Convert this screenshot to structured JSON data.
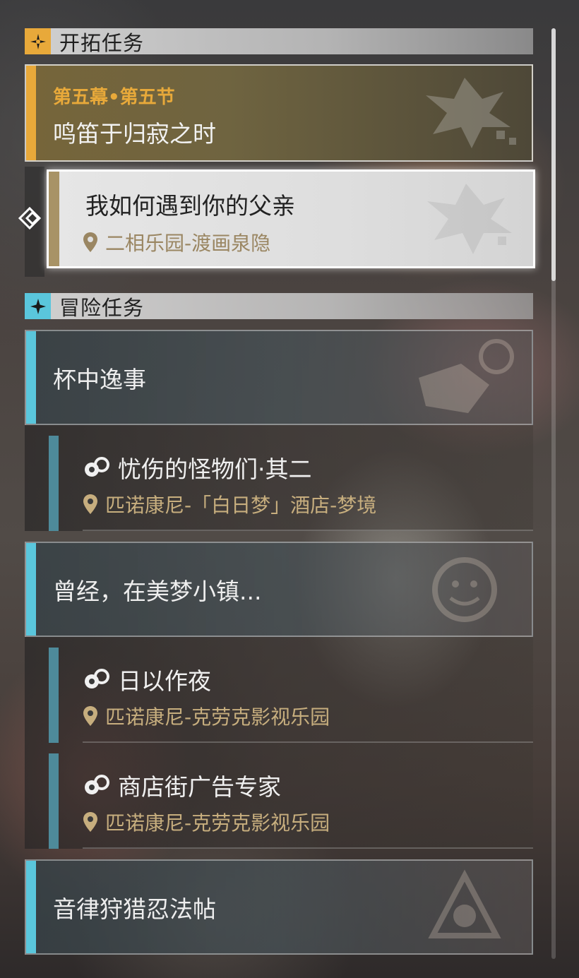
{
  "trailblaze": {
    "header": "开拓任务",
    "chapter": "第五幕•第五节",
    "title": "鸣笛于归寂之时",
    "current": {
      "title": "我如何遇到你的父亲",
      "location": "二相乐园-渡画泉隐"
    }
  },
  "adventure": {
    "header": "冒险任务",
    "groups": [
      {
        "title": "杯中逸事",
        "subs": [
          {
            "title": "忧伤的怪物们·其二",
            "location": "匹诺康尼-「白日梦」酒店-梦境"
          }
        ]
      },
      {
        "title": "曾经，在美梦小镇...",
        "subs": [
          {
            "title": "日以作夜",
            "location": "匹诺康尼-克劳克影视乐园"
          },
          {
            "title": "商店街广告专家",
            "location": "匹诺康尼-克劳克影视乐园"
          }
        ]
      },
      {
        "title": "音律狩猎忍法帖",
        "subs": []
      }
    ]
  },
  "colors": {
    "trailblaze_accent": "#e8a93a",
    "adventure_accent": "#5ac6dc",
    "sub_bar": "#4e8a9a",
    "location_text": "#c7ae7e"
  },
  "icons": {
    "trailblaze_section": "sparkle-compass-icon",
    "adventure_section": "four-point-star-icon",
    "location": "map-pin-icon",
    "quest": "swirl-quest-icon",
    "selector": "diamond-arrow-icon"
  }
}
